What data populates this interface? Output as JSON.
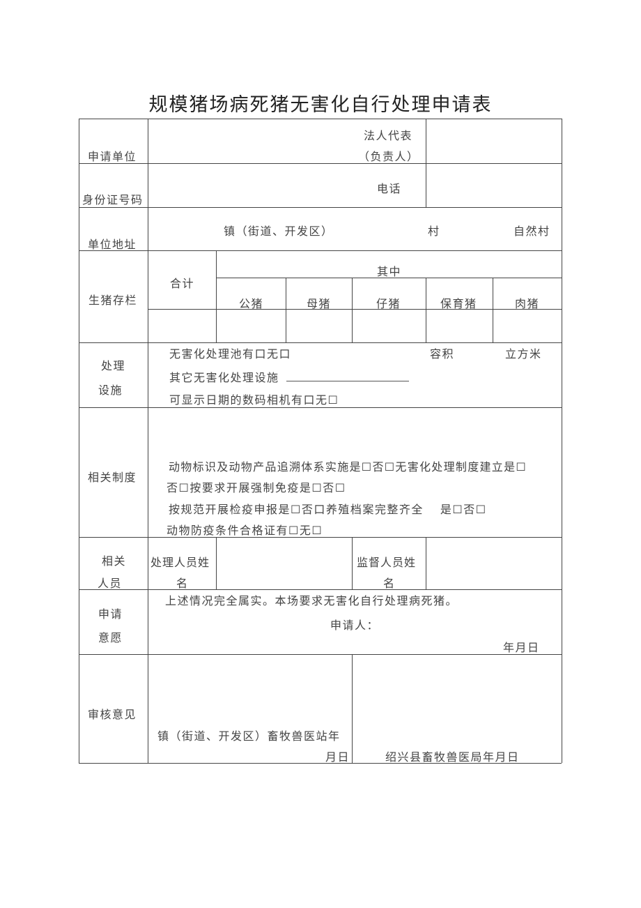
{
  "title": "规模猪场病死猪无害化自行处理申请表",
  "rows": {
    "applicant": {
      "label": "申请单位",
      "legal_rep_line1": "法人代表",
      "legal_rep_line2": "（负责人）"
    },
    "id_number": {
      "label": "身份证号码",
      "phone_label": "电话"
    },
    "address": {
      "label": "单位地址",
      "town": "镇（街道、开发区）",
      "village": "村",
      "natural_village": "自然村"
    },
    "stock": {
      "label": "生猪存栏",
      "total": "合计",
      "of_which": "其中",
      "categories": [
        "公猪",
        "母猪",
        "仔猪",
        "保育猪",
        "肉猪"
      ]
    },
    "facility": {
      "label_line1": "处理",
      "label_line2": "设施",
      "line1": "无害化处理池有口无口",
      "volume": "容积",
      "unit": "立方米",
      "line2": "其它无害化处理设施",
      "line3": "可显示日期的数码相机有口无☐"
    },
    "systems": {
      "label": "相关制度",
      "line1": "动物标识及动物产品追溯体系实施是☐否☐无害化处理制度建立是☐",
      "line2": "否☐按要求开展强制免疫是☐否☐",
      "line3": "按规范开展检疫申报是☐否口养殖档案完整齐全　 是☐否☐",
      "line4": "动物防疫条件合格证有☐无☐"
    },
    "personnel": {
      "label_line1": "相关",
      "label_line2": "人员",
      "handler_line1": "处理人员姓",
      "handler_line2": "名",
      "supervisor_line1": "监督人员姓",
      "supervisor_line2": "名"
    },
    "intent": {
      "label_line1": "申请",
      "label_line2": "意愿",
      "statement": "上述情况完全属实。本场要求无害化自行处理病死猪。",
      "applicant": "申请人：",
      "date": "年月日"
    },
    "review": {
      "label": "审核意见",
      "town_station_line1": "镇（街道、开发区）畜牧兽医站年",
      "town_station_line2": "月日",
      "county_bureau": "绍兴县畜牧兽医局年月日"
    }
  }
}
